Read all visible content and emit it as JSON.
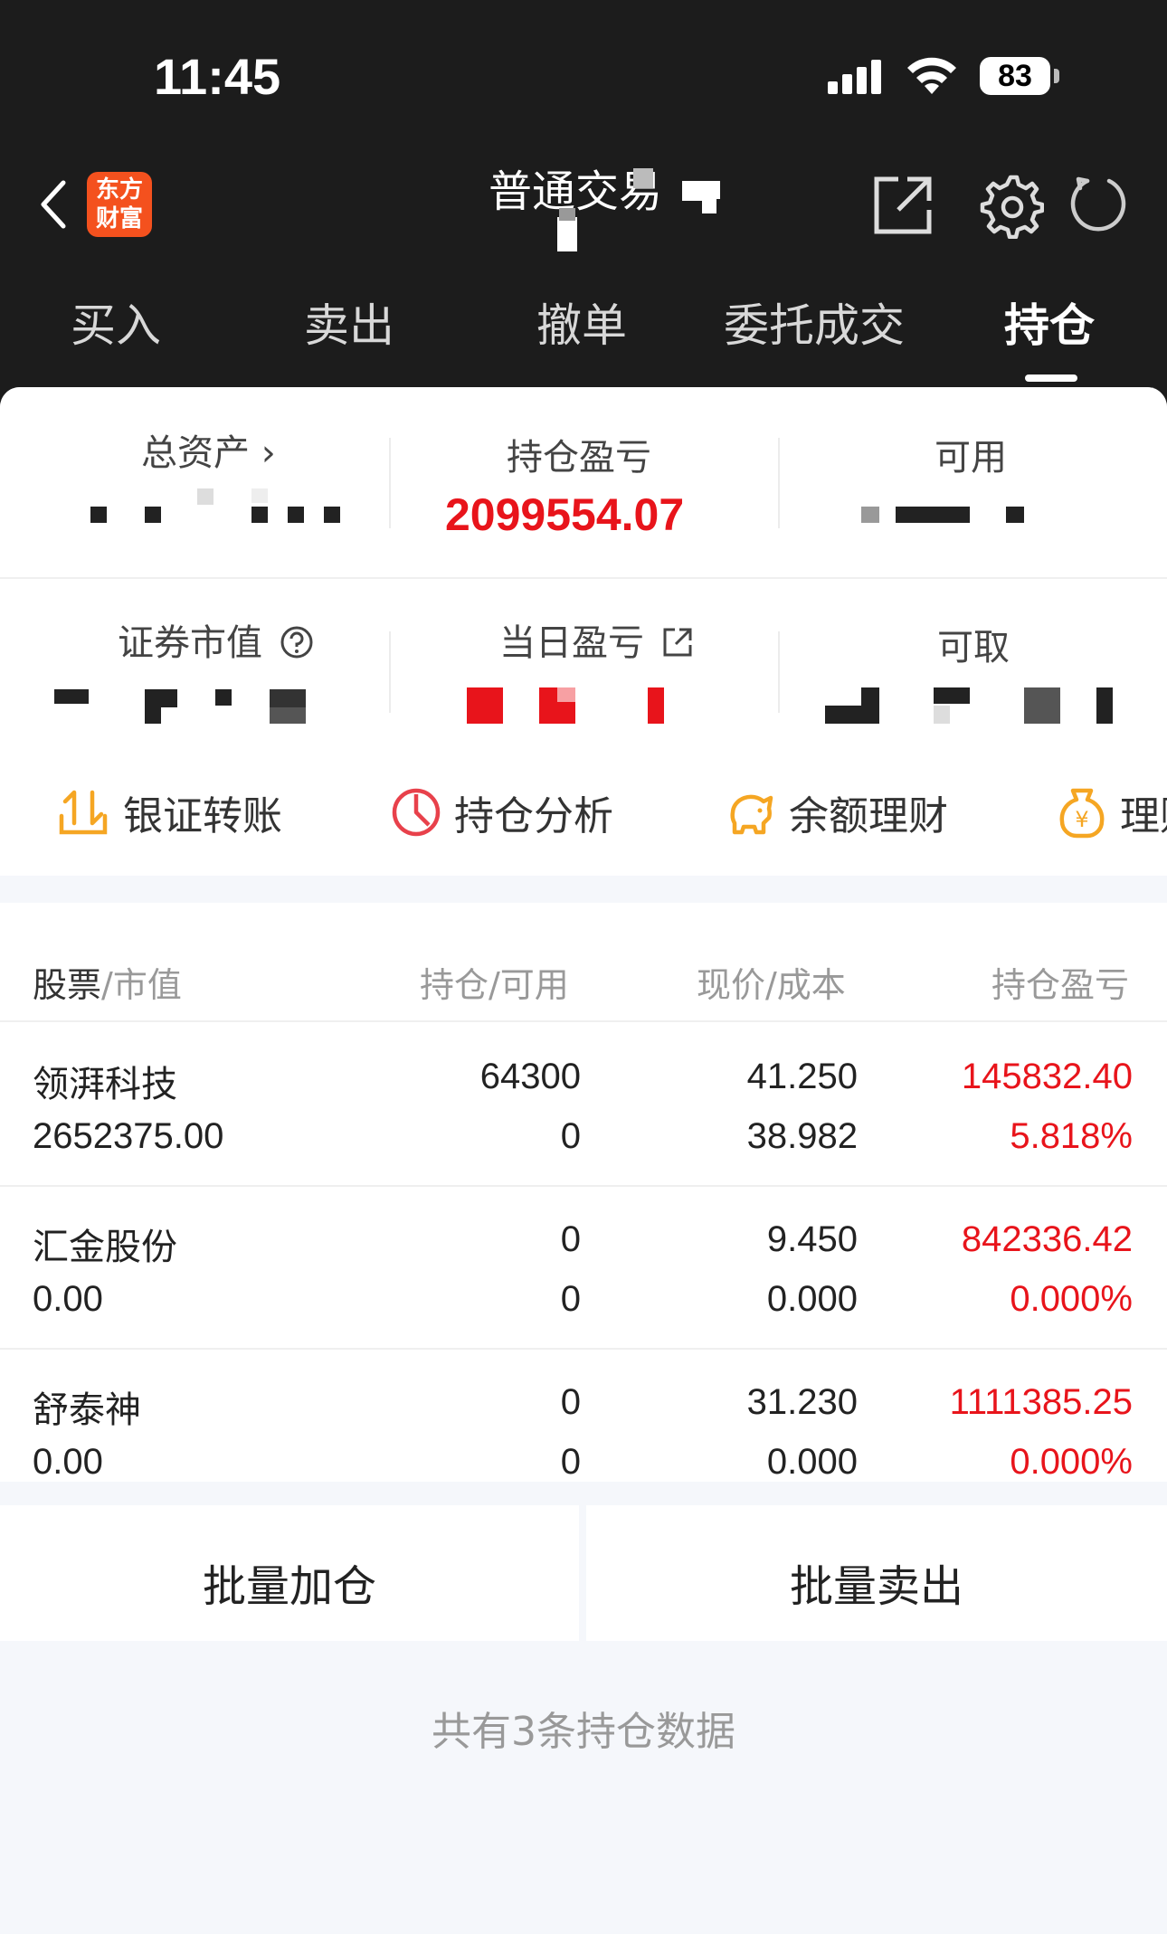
{
  "status_bar": {
    "time": "11:45",
    "battery": "83"
  },
  "header": {
    "title": "普通交易",
    "logo_text_top": "东方",
    "logo_text_bottom": "财富"
  },
  "tabs": [
    {
      "label": "买入"
    },
    {
      "label": "卖出"
    },
    {
      "label": "撤单"
    },
    {
      "label": "委托成交"
    },
    {
      "label": "持仓"
    }
  ],
  "summary": {
    "total_assets_label": "总资产 ›",
    "position_pl_label": "持仓盈亏",
    "position_pl_value": "2099554.07",
    "available_label": "可用",
    "market_value_label": "证券市值",
    "daily_pl_label": "当日盈亏",
    "withdrawable_label": "可取"
  },
  "quick_actions": [
    {
      "label": "银证转账",
      "icon": "transfer-icon"
    },
    {
      "label": "持仓分析",
      "icon": "pie-chart-icon"
    },
    {
      "label": "余额理财",
      "icon": "piggy-bank-icon"
    },
    {
      "label": "理财",
      "icon": "money-bag-icon"
    }
  ],
  "table": {
    "headers": {
      "stock": "股票",
      "market_value": "/市值",
      "position": "持仓/可用",
      "price": "现价/成本",
      "pl": "持仓盈亏"
    },
    "rows": [
      {
        "name": "领湃科技",
        "market_value": "2652375.00",
        "position": "64300",
        "available": "0",
        "price": "41.250",
        "cost": "38.982",
        "pl": "145832.40",
        "pl_pct": "5.818%"
      },
      {
        "name": "汇金股份",
        "market_value": "0.00",
        "position": "0",
        "available": "0",
        "price": "9.450",
        "cost": "0.000",
        "pl": "842336.42",
        "pl_pct": "0.000%"
      },
      {
        "name": "舒泰神",
        "market_value": "0.00",
        "position": "0",
        "available": "0",
        "price": "31.230",
        "cost": "0.000",
        "pl": "1111385.25",
        "pl_pct": "0.000%"
      }
    ]
  },
  "buttons": {
    "batch_add": "批量加仓",
    "batch_sell": "批量卖出"
  },
  "footer": "共有3条持仓数据",
  "colors": {
    "accent_red": "#e8141b",
    "header_bg": "#1c1c1c",
    "logo_orange": "#f4511e",
    "icon_orange": "#f5a623",
    "icon_red": "#e8414b"
  }
}
